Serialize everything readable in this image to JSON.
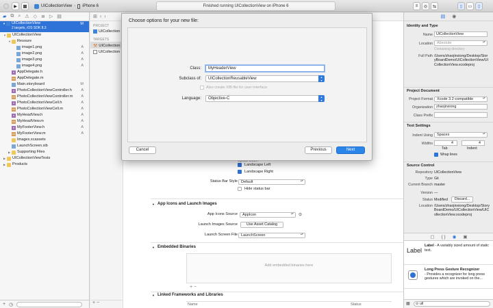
{
  "toolbar": {
    "scheme_project": "UICollectionView",
    "scheme_device": "iPhone 6",
    "activity_text": "Finished running UICollectionView on iPhone 6"
  },
  "navigator": {
    "tabs_icons": [
      "folder-icon",
      "symbol-icon",
      "search-icon",
      "warning-icon",
      "test-icon",
      "debug-icon",
      "breakpoint-icon",
      "report-icon"
    ],
    "project": {
      "name": "UICollectionView",
      "subtitle": "2 targets, iOS SDK 8.3",
      "status": "M"
    },
    "items": [
      {
        "label": "UICollectionView",
        "kind": "folder",
        "indent": 1,
        "status": ""
      },
      {
        "label": "Resoure",
        "kind": "folder",
        "indent": 2,
        "status": ""
      },
      {
        "label": "image1.png",
        "kind": "png",
        "indent": 3,
        "status": "A"
      },
      {
        "label": "image2.png",
        "kind": "png",
        "indent": 3,
        "status": "A"
      },
      {
        "label": "image3.png",
        "kind": "png",
        "indent": 3,
        "status": "A"
      },
      {
        "label": "image4.png",
        "kind": "png",
        "indent": 3,
        "status": "A"
      },
      {
        "label": "AppDelegate.h",
        "kind": "h",
        "indent": 2,
        "status": ""
      },
      {
        "label": "AppDelegate.m",
        "kind": "m",
        "indent": 2,
        "status": ""
      },
      {
        "label": "Main.storyboard",
        "kind": "sb",
        "indent": 2,
        "status": "M"
      },
      {
        "label": "PhotoCollectionViewController.h",
        "kind": "h",
        "indent": 2,
        "status": "A"
      },
      {
        "label": "PhotoCollectionViewController.m",
        "kind": "m",
        "indent": 2,
        "status": "A"
      },
      {
        "label": "PhotoCollectionViewCell.h",
        "kind": "h",
        "indent": 2,
        "status": "A"
      },
      {
        "label": "PhotoCollectionViewCell.m",
        "kind": "m",
        "indent": 2,
        "status": "A"
      },
      {
        "label": "MyHeadView.h",
        "kind": "h",
        "indent": 2,
        "status": "A"
      },
      {
        "label": "MyHeadView.m",
        "kind": "m",
        "indent": 2,
        "status": "A"
      },
      {
        "label": "MyFooterView.h",
        "kind": "h",
        "indent": 2,
        "status": "A"
      },
      {
        "label": "MyFooterView.m",
        "kind": "m",
        "indent": 2,
        "status": "A"
      },
      {
        "label": "Images.xcassets",
        "kind": "folder",
        "indent": 2,
        "status": ""
      },
      {
        "label": "LaunchScreen.xib",
        "kind": "sb",
        "indent": 2,
        "status": ""
      },
      {
        "label": "Supporting Files",
        "kind": "folder",
        "indent": 2,
        "status": ""
      },
      {
        "label": "UICollectionViewTests",
        "kind": "folder",
        "indent": 1,
        "status": ""
      },
      {
        "label": "Products",
        "kind": "folder",
        "indent": 1,
        "status": ""
      }
    ]
  },
  "editor": {
    "targets_panel": {
      "project_header": "PROJECT",
      "project_item": "UICollection",
      "targets_header": "TARGETS",
      "target_items": [
        "UICollection",
        "UICollection"
      ]
    },
    "orientation": {
      "landscape_left": "Landscape Left",
      "landscape_right": "Landscape Right",
      "status_bar_style_label": "Status Bar Style",
      "status_bar_style_value": "Default",
      "hide_status_bar": "Hide status bar"
    },
    "app_icons": {
      "section_title": "App Icons and Launch Images",
      "icons_source_label": "App Icons Source",
      "icons_source_value": "AppIcon",
      "launch_images_label": "Launch Images Source",
      "launch_images_button": "Use Asset Catalog",
      "launch_screen_label": "Launch Screen File",
      "launch_screen_value": "LaunchScreen"
    },
    "embedded": {
      "section_title": "Embedded Binaries",
      "placeholder": "Add embedded binaries here"
    },
    "linked": {
      "section_title": "Linked Frameworks and Libraries",
      "col_name": "Name",
      "col_status": "Status"
    }
  },
  "sheet": {
    "title": "Choose options for your new file:",
    "class_label": "Class:",
    "class_value": "MyHeaderView",
    "subclass_label": "Subclass of:",
    "subclass_value": "UICollectionReusableView",
    "xib_label": "Also create XIB file for user interface",
    "language_label": "Language:",
    "language_value": "Objective-C",
    "cancel": "Cancel",
    "previous": "Previous",
    "next": "Next"
  },
  "inspector": {
    "identity_header": "Identity and Type",
    "name_label": "Name",
    "name_value": "UICollectionView",
    "location_label": "Location",
    "location_value": "Absolute",
    "containing_dir": "Containing directory",
    "fullpath_label": "Full Path",
    "fullpath_value": "/Users/zhaojinxiong/Desktop/StoryBoardDemo/UICollectionView/UICollectionView.xcodeproj",
    "projdoc_header": "Project Document",
    "format_label": "Project Format",
    "format_value": "Xcode 3.2-compatible",
    "org_label": "Organization",
    "org_value": "zhaojinxiong",
    "prefix_label": "Class Prefix",
    "textset_header": "Text Settings",
    "indent_label": "Indent Using",
    "indent_value": "Spaces",
    "widths_label": "Widths",
    "tab_value": "4",
    "indent_value_num": "4",
    "tab_caption": "Tab",
    "indent_caption": "Indent",
    "wrap_lines": "Wrap lines",
    "sc_header": "Source Control",
    "repo_label": "Repository",
    "repo_value": "UICollectionView",
    "type_label": "Type",
    "type_value": "Git",
    "branch_label": "Current Branch",
    "branch_value": "master",
    "version_label": "Version",
    "version_value": "—",
    "status_label": "Status",
    "status_value": "Modified",
    "discard_button": "Discard...",
    "loc2_label": "Location",
    "loc2_value": "/Users/zhaojinxiong/Desktop/StoryBoardDemo/UICollectionView/UICollectionView.xcodeproj",
    "library": [
      {
        "badge": "Label",
        "title": "Label",
        "desc": " - A variably sized amount of static text."
      },
      {
        "badge": "",
        "title": "Long Press Gesture Recognizer",
        "desc": " - Provides a recognizer for long press gestures which are invoked on the..."
      }
    ],
    "lib_filter": "ull"
  },
  "colors": {
    "accent": "#2f72d8",
    "next_button": "#2b84e8"
  }
}
